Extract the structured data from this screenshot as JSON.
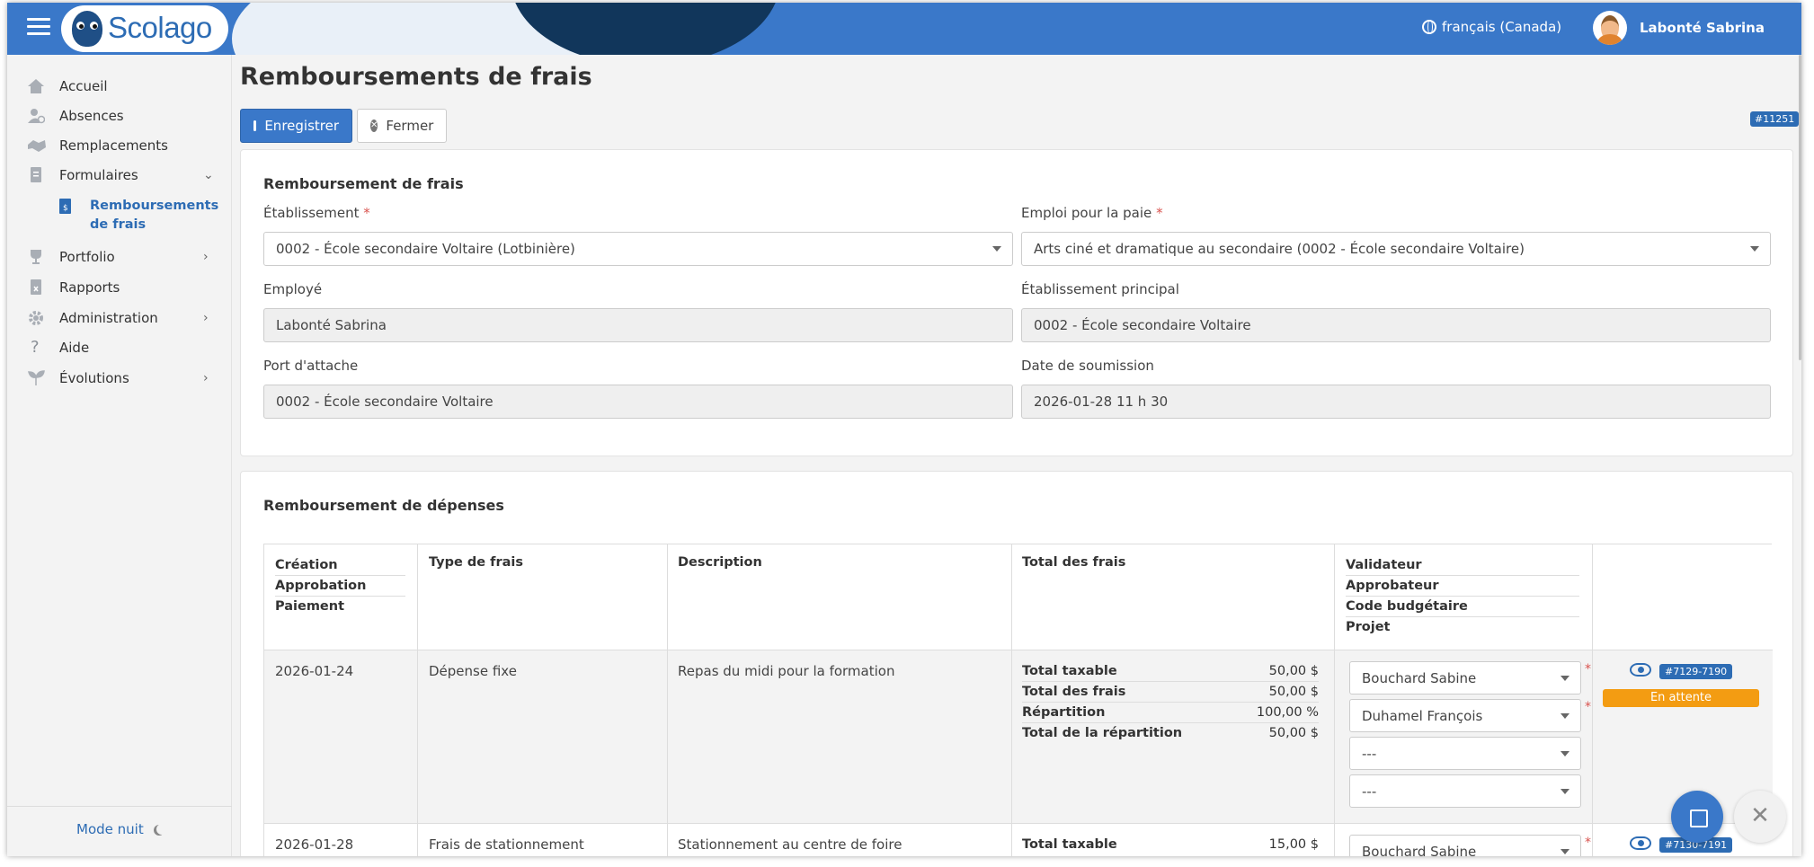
{
  "header": {
    "logo": "Scolago",
    "language": "français (Canada)",
    "user": "Labonté Sabrina"
  },
  "sidebar": {
    "items": [
      {
        "label": "Accueil",
        "icon": "home-icon"
      },
      {
        "label": "Absences",
        "icon": "user-clock-icon"
      },
      {
        "label": "Remplacements",
        "icon": "handshake-icon"
      },
      {
        "label": "Formulaires",
        "icon": "forms-icon"
      },
      {
        "label": "Portfolio",
        "icon": "trophy-icon"
      },
      {
        "label": "Rapports",
        "icon": "report-icon"
      },
      {
        "label": "Administration",
        "icon": "gear-icon"
      },
      {
        "label": "Aide",
        "icon": "question-icon"
      },
      {
        "label": "Évolutions",
        "icon": "sprout-icon"
      }
    ],
    "sub_item": "Remboursements de frais",
    "night_mode": "Mode nuit"
  },
  "page": {
    "title": "Remboursements de frais",
    "save": "Enregistrer",
    "close": "Fermer",
    "id_tag": "#11251"
  },
  "form": {
    "title": "Remboursement de frais",
    "etablissement_label": "Établissement",
    "etablissement_value": "0002 - École secondaire Voltaire (Lotbinière)",
    "emploi_label": "Emploi pour la paie",
    "emploi_value": "Arts ciné et dramatique au secondaire (0002 - École secondaire Voltaire)",
    "employe_label": "Employé",
    "employe_value": "Labonté Sabrina",
    "etab_principal_label": "Établissement principal",
    "etab_principal_value": "0002 - École secondaire Voltaire",
    "port_label": "Port d'attache",
    "port_value": "0002 - École secondaire Voltaire",
    "date_label": "Date de soumission",
    "date_value": "2026-01-28 11 h 30",
    "required_mark": "*"
  },
  "expenses": {
    "title": "Remboursement de dépenses",
    "headers": {
      "dates": [
        "Création",
        "Approbation",
        "Paiement"
      ],
      "type": "Type de frais",
      "description": "Description",
      "total": "Total des frais",
      "people": [
        "Validateur",
        "Approbateur",
        "Code budgétaire",
        "Projet"
      ]
    },
    "rows": [
      {
        "date": "2026-01-24",
        "type": "Dépense fixe",
        "description": "Repas du midi pour la formation",
        "totals": [
          {
            "label": "Total taxable",
            "value": "50,00 $"
          },
          {
            "label": "Total des frais",
            "value": "50,00 $"
          },
          {
            "label": "Répartition",
            "value": "100,00 %"
          },
          {
            "label": "Total de la répartition",
            "value": "50,00 $"
          }
        ],
        "validateur": "Bouchard Sabine",
        "approbateur": "Duhamel François",
        "code": "---",
        "projet": "---",
        "ref": "#7129-7190",
        "status": "En attente"
      },
      {
        "date": "2026-01-28",
        "type": "Frais de stationnement",
        "description": "Stationnement au centre de foire",
        "totals": [
          {
            "label": "Total taxable",
            "value": "15,00 $"
          }
        ],
        "validateur": "Bouchard Sabine",
        "ref": "#7130-7191"
      }
    ]
  },
  "colors": {
    "primary": "#3a78c9",
    "status_pending": "#f39c12",
    "required": "#d9534f"
  }
}
